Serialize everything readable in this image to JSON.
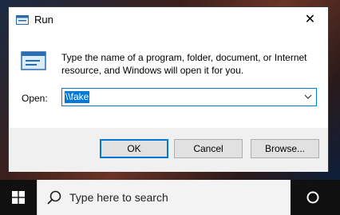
{
  "dialog": {
    "title": "Run",
    "description": "Type the name of a program, folder, document, or Internet resource, and Windows will open it for you.",
    "open_label": "Open:",
    "open_value": "\\\\fake",
    "buttons": {
      "ok": "OK",
      "cancel": "Cancel",
      "browse": "Browse..."
    }
  },
  "taskbar": {
    "search_placeholder": "Type here to search"
  },
  "icons": [
    "run-app-icon",
    "close-icon",
    "run-large-icon",
    "chevron-down-icon",
    "windows-start-icon",
    "search-icon",
    "cortana-icon"
  ],
  "colors": {
    "accent": "#0078d7",
    "taskbar": "#101010",
    "footer": "#f0f0f0"
  }
}
